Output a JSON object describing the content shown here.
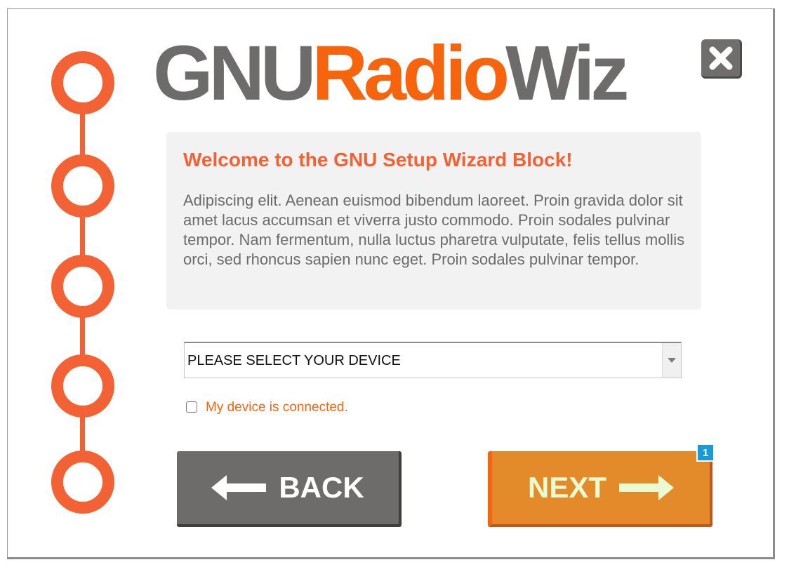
{
  "logo": {
    "part1": "GNU",
    "part2": "Radio",
    "part3": "Wiz"
  },
  "steps": {
    "count": 5
  },
  "close_icon": "close-icon",
  "welcome": {
    "title": "Welcome to the GNU Setup Wizard Block!",
    "body": "Adipiscing elit. Aenean euismod bibendum laoreet. Proin gravida dolor sit amet lacus accumsan et viverra justo commodo. Proin sodales pulvinar tempor. Nam fermentum, nulla luctus pharetra vulputate, felis tellus mollis orci, sed rhoncus sapien nunc eget. Proin sodales pulvinar tempor."
  },
  "device_select": {
    "value": "PLEASE SELECT YOUR DEVICE"
  },
  "connected_checkbox": {
    "label": "My device is connected.",
    "checked": false
  },
  "buttons": {
    "back_label": "BACK",
    "next_label": "NEXT",
    "next_badge": "1"
  },
  "colors": {
    "accent_orange": "#f26234",
    "logo_orange": "#f7640e",
    "logo_gray": "#6d6c6a",
    "next_button": "#e38b2a",
    "back_button": "#6d6c6a",
    "badge": "#1a9ad6"
  }
}
